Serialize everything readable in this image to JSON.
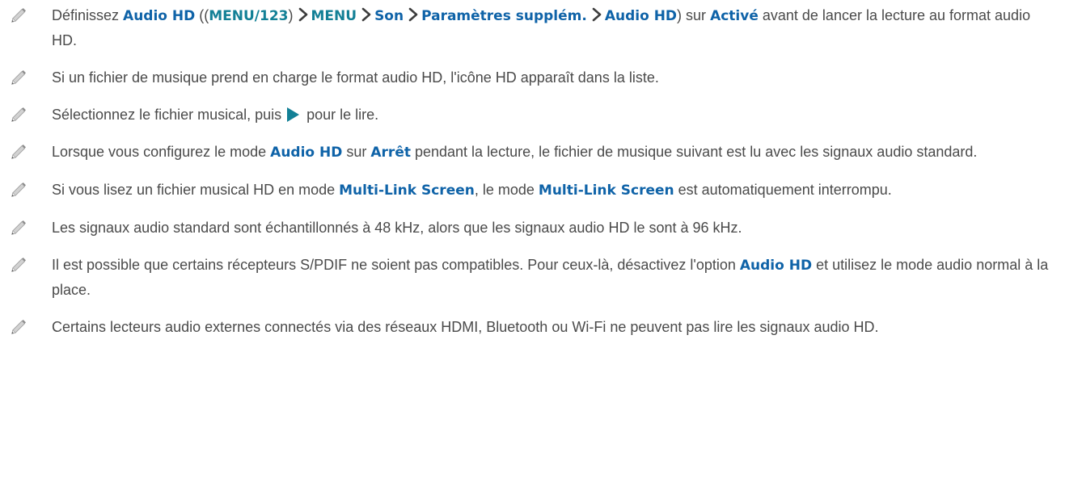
{
  "icons": {
    "note": "pencil-icon",
    "separator": "chevron-right-icon",
    "play": "play-icon"
  },
  "colors": {
    "menu_term": "#0f63a8",
    "menu_path": "#138096",
    "text": "#4a4a4a"
  },
  "notes": [
    {
      "t1": "Définissez ",
      "b1": "Audio HD",
      "t2": " ((",
      "path": [
        "MENU/123",
        "MENU",
        "Son",
        "Paramètres supplém.",
        "Audio HD"
      ],
      "t3": ") sur ",
      "b2": "Activé",
      "t4": " avant de lancer la lecture au format audio HD."
    },
    {
      "text": "Si un fichier de musique prend en charge le format audio HD, l'icône HD apparaît dans la liste."
    },
    {
      "t1": "Sélectionnez le fichier musical, puis ",
      "t2": " pour le lire."
    },
    {
      "t1": "Lorsque vous configurez le mode ",
      "b1": "Audio HD",
      "t2": " sur ",
      "b2": "Arrêt",
      "t3": " pendant la lecture, le fichier de musique suivant est lu avec les signaux audio standard."
    },
    {
      "t1": "Si vous lisez un fichier musical HD en mode ",
      "b1": "Multi-Link Screen",
      "t2": ", le mode ",
      "b2": "Multi-Link Screen",
      "t3": " est automatiquement interrompu."
    },
    {
      "text": "Les signaux audio standard sont échantillonnés à 48 kHz, alors que les signaux audio HD le sont à 96 kHz."
    },
    {
      "t1": "Il est possible que certains récepteurs S/PDIF ne soient pas compatibles. Pour ceux-là, désactivez l'option ",
      "b1": "Audio HD",
      "t2": " et utilisez le mode audio normal à la place."
    },
    {
      "text": "Certains lecteurs audio externes connectés via des réseaux HDMI, Bluetooth ou Wi-Fi ne peuvent pas lire les signaux audio HD."
    }
  ]
}
